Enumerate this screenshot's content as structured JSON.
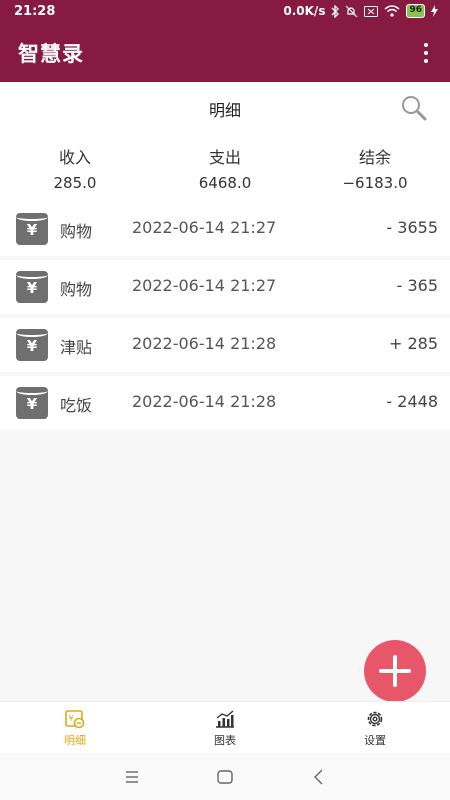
{
  "status_bar": {
    "time": "21:28",
    "network_speed": "0.0K/s",
    "battery": "96"
  },
  "app_bar": {
    "title": "智慧录"
  },
  "header": {
    "title": "明细"
  },
  "summary": {
    "income_label": "收入",
    "income_value": "285.0",
    "expense_label": "支出",
    "expense_value": "6468.0",
    "balance_label": "结余",
    "balance_value": "−6183.0"
  },
  "records": [
    {
      "category": "购物",
      "datetime": "2022-06-14 21:27",
      "amount": "- 3655"
    },
    {
      "category": "购物",
      "datetime": "2022-06-14 21:27",
      "amount": "- 365"
    },
    {
      "category": "津贴",
      "datetime": "2022-06-14 21:28",
      "amount": "+ 285"
    },
    {
      "category": "吃饭",
      "datetime": "2022-06-14 21:28",
      "amount": "- 2448"
    }
  ],
  "nav": [
    {
      "label": "明细",
      "icon": "detail-icon",
      "active": true
    },
    {
      "label": "图表",
      "icon": "chart-icon",
      "active": false
    },
    {
      "label": "设置",
      "icon": "settings-gear-icon",
      "active": false
    }
  ],
  "colors": {
    "primary": "#861a40",
    "accent": "#e8566a",
    "active_tab": "#e0a814"
  }
}
